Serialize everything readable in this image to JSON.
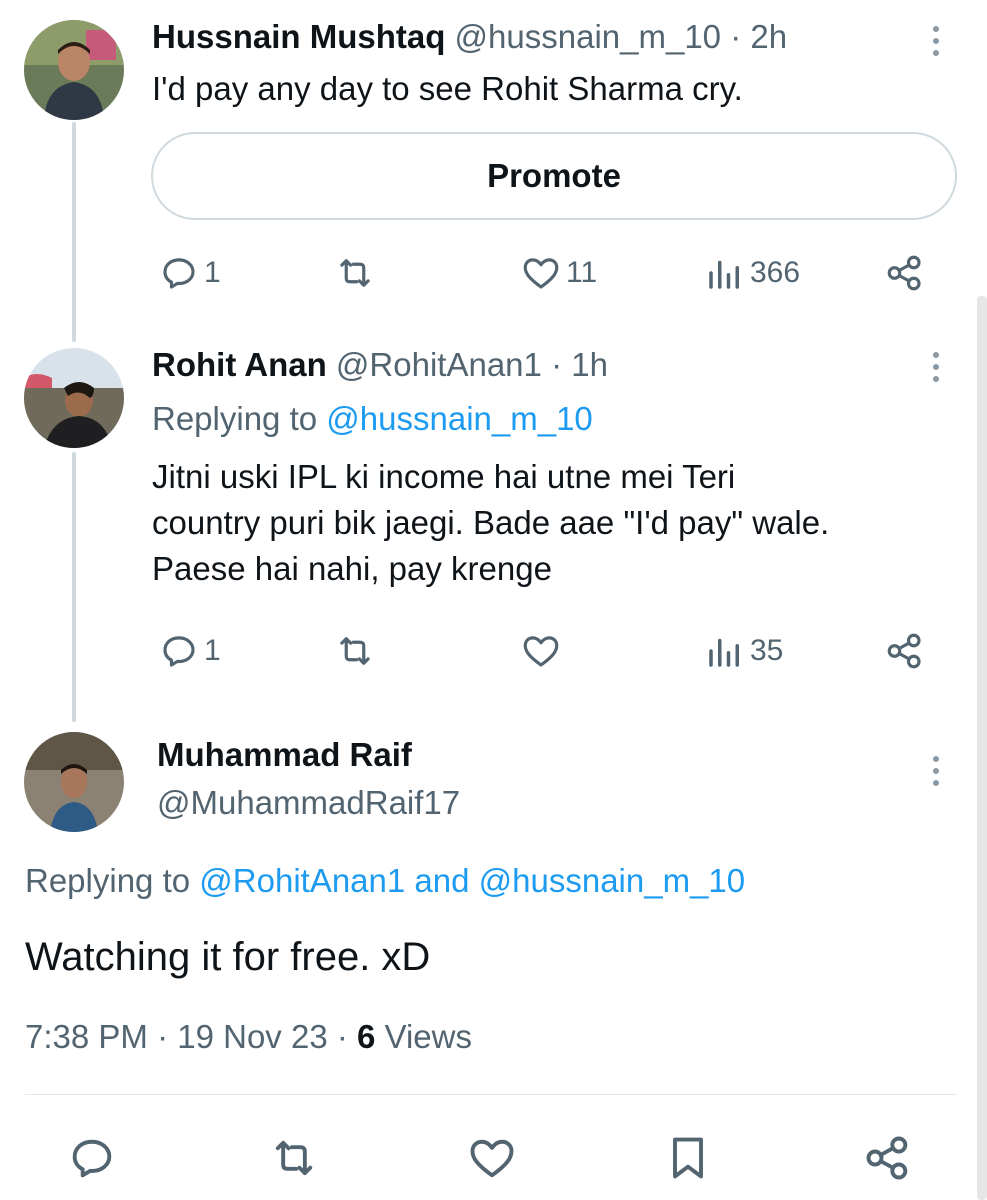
{
  "tweet1": {
    "name": "Hussnain Mushtaq",
    "handle": "@hussnain_m_10",
    "time": "2h",
    "text": "I'd pay any day to see Rohit Sharma cry.",
    "promote_label": "Promote",
    "replies": "1",
    "likes": "11",
    "views": "366"
  },
  "tweet2": {
    "name": "Rohit Anan",
    "handle": "@RohitAnan1",
    "time": "1h",
    "replying_prefix": "Replying to",
    "replying_to": "@hussnain_m_10",
    "text_line1": "Jitni uski IPL ki income hai utne mei Teri",
    "text_line2": "country puri bik jaegi. Bade aae \"I'd pay\" wale.",
    "text_line3": "Paese hai nahi, pay krenge",
    "replies": "1",
    "views": "35"
  },
  "tweet3": {
    "name": "Muhammad Raif",
    "handle": "@MuhammadRaif17",
    "replying_prefix": "Replying to",
    "replying_to": "@RohitAnan1 and @hussnain_m_10",
    "text": "Watching it for free. xD",
    "time": "7:38 PM",
    "date": "19 Nov 23",
    "views_count": "6",
    "views_label": "Views"
  },
  "icons": [
    "reply-icon",
    "retweet-icon",
    "like-icon",
    "views-icon",
    "share-icon",
    "bookmark-icon",
    "more-icon"
  ],
  "colors": {
    "accent": "#1d9bf0",
    "muted": "#536471",
    "text": "#0f1419",
    "thread_line": "#cfd9de"
  }
}
